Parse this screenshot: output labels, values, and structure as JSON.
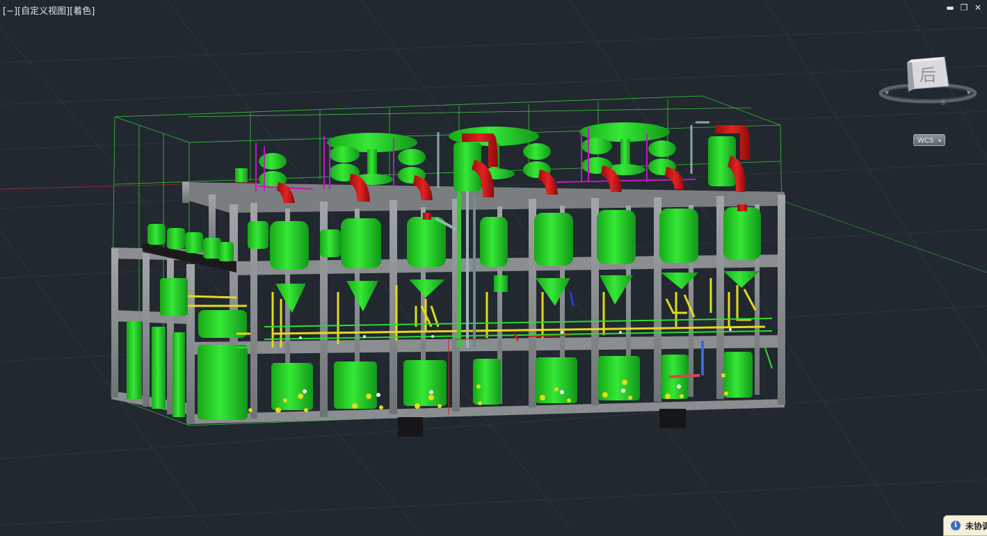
{
  "viewport": {
    "label_minus": "[−]",
    "label_view": "[自定义视图]",
    "label_style": "[着色]"
  },
  "window_controls": {
    "minimize": "▬",
    "restore": "❐",
    "close": "✕"
  },
  "viewcube": {
    "face_label": "后",
    "compass_letter": "东"
  },
  "wcs": {
    "label": "WCS",
    "caret": "▾"
  },
  "notification": {
    "icon": "i",
    "text": "未协调"
  },
  "colors": {
    "background": "#212830",
    "grid_line": "#2c343d",
    "steel": "#8e9294",
    "equipment": "#22d122",
    "pipe_red": "#d41a1a",
    "pipe_yellow": "#e3da1c",
    "pipe_magenta": "#c316c3",
    "bounding_wire": "#3ec33e"
  },
  "icons": [
    "info-icon",
    "minimize-icon",
    "restore-icon",
    "close-icon"
  ]
}
